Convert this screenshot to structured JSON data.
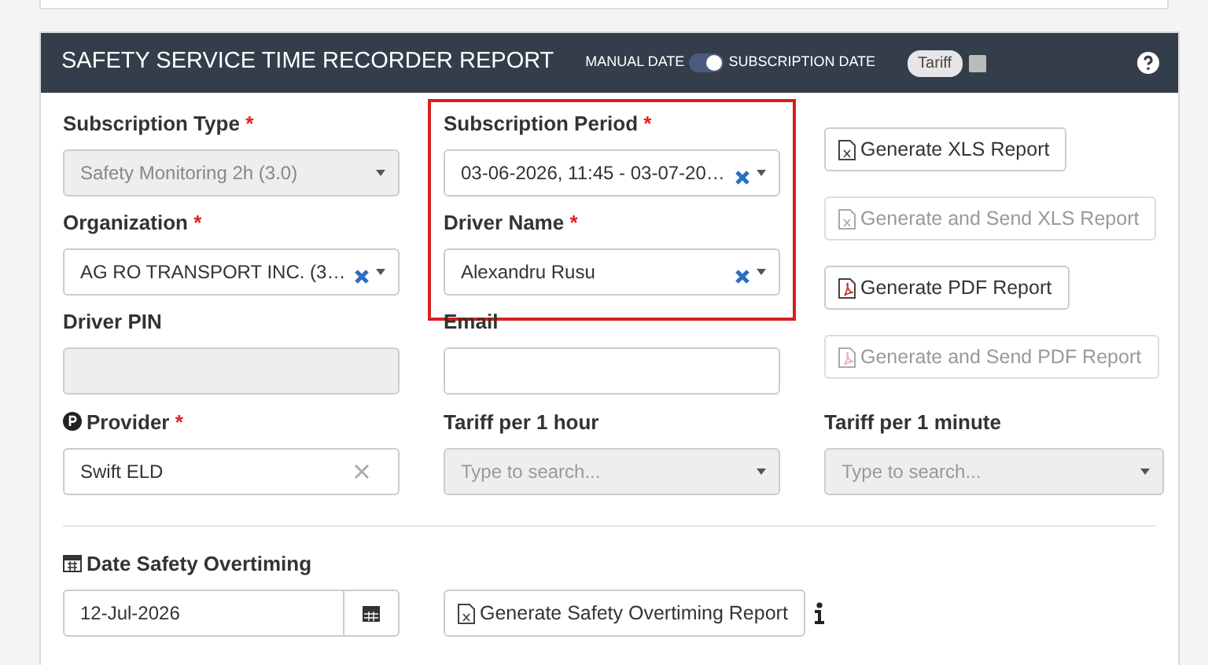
{
  "header": {
    "title": "SAFETY SERVICE TIME RECORDER REPORT",
    "toggle": {
      "left_label": "MANUAL DATE",
      "right_label": "SUBSCRIPTION DATE",
      "on": true
    },
    "tariff": {
      "label": "Tariff",
      "checked": false
    }
  },
  "columns": [
    {
      "fields": [
        {
          "kind": "select",
          "label": "Subscription Type",
          "required_mark": "*",
          "value": "Safety Monitoring 2h (3.0)",
          "disabled": true,
          "clearable": false,
          "highlighted": false
        },
        {
          "kind": "select",
          "label": "Organization",
          "required_mark": "*",
          "value": "AG RO TRANSPORT INC. (3…",
          "disabled": false,
          "clearable": true,
          "highlighted": false
        },
        {
          "kind": "text",
          "label": "Driver PIN",
          "disabled": true,
          "clearable": false,
          "highlighted": false
        }
      ]
    },
    {
      "fields": [
        {
          "kind": "select",
          "label": "Subscription Period",
          "required_mark": "*",
          "value": "03-06-2026, 11:45 - 03-07-20…",
          "disabled": false,
          "clearable": true,
          "highlighted": true
        },
        {
          "kind": "select",
          "label": "Driver Name",
          "required_mark": "*",
          "value": "Alexandru Rusu",
          "disabled": false,
          "clearable": true,
          "highlighted": true
        },
        {
          "kind": "text",
          "label": "Email",
          "disabled": false,
          "clearable": false,
          "highlighted": false
        }
      ]
    }
  ],
  "report_buttons": [
    {
      "kind": "xls",
      "label": "Generate XLS Report",
      "disabled": false
    },
    {
      "kind": "xls",
      "label": "Generate and Send XLS Report",
      "disabled": true
    },
    {
      "kind": "pdf",
      "label": "Generate PDF Report",
      "disabled": false
    },
    {
      "kind": "pdf",
      "label": "Generate and Send PDF Report",
      "disabled": true
    }
  ],
  "bottom_fields": [
    {
      "kind": "provider",
      "label": "Provider",
      "required_mark": "*",
      "value": "Swift ELD",
      "clearable": true,
      "disabled": false
    },
    {
      "kind": "select",
      "label": "Tariff per 1 hour",
      "placeholder": "Type to search...",
      "clearable": false,
      "disabled": true
    },
    {
      "kind": "select",
      "label": "Tariff per 1 minute",
      "placeholder": "Type to search...",
      "clearable": false,
      "disabled": true
    }
  ],
  "overtime": {
    "label": "Date Safety Overtiming",
    "date": "12-Jul-2026",
    "button": "Generate Safety Overtiming Report"
  }
}
